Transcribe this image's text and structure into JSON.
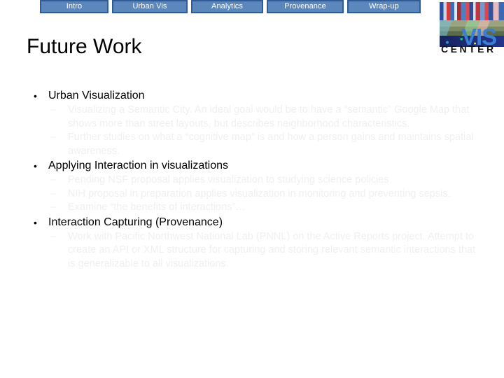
{
  "nav": {
    "tabs": [
      {
        "label": "Intro",
        "width_class": "w-intro"
      },
      {
        "label": "Urban Vis",
        "width_class": "w-urbanvis"
      },
      {
        "label": "Analytics",
        "width_class": "w-analytics"
      },
      {
        "label": "Provenance",
        "width_class": "w-provenance"
      },
      {
        "label": "Wrap-up",
        "width_class": "w-wrapup"
      }
    ],
    "tab_fill_color": "#5b87bd",
    "tab_border_color": "#2f5c98",
    "tab_text_color": "#ffffff"
  },
  "logo": {
    "word_primary": "VIS",
    "word_secondary": "CENTER",
    "primary_color": "#3b7fd4",
    "secondary_color": "#111111"
  },
  "slide": {
    "title": "Future Work",
    "title_color": "#000000",
    "body_level1_color": "#000000",
    "body_level2_color": "#f0f0f0",
    "bullet_marker_level1": "•",
    "bullet_marker_level2": "–",
    "bullets": [
      {
        "level": 1,
        "text": "Urban Visualization"
      },
      {
        "level": 2,
        "text": "Visualizing a Semantic City.  An ideal goal would be to have a “semantic” Google Map that shows more than street layouts, but describes neighborhood characteristics."
      },
      {
        "level": 2,
        "text": "Further studies on what a “cognitive map” is and how a person gains and maintains spatial awareness."
      },
      {
        "level": 1,
        "text": "Applying Interaction in visualizations"
      },
      {
        "level": 2,
        "text": "Pending NSF proposal applies visualization to studying science policies"
      },
      {
        "level": 2,
        "text": "NIH proposal in preparation applies visualization in monitoring and preventing sepsis."
      },
      {
        "level": 2,
        "text": "Examine “the benefits of interactions”…"
      },
      {
        "level": 1,
        "text": "Interaction Capturing (Provenance)"
      },
      {
        "level": 2,
        "text": "Work with Pacific Northwest National Lab (PNNL) on the Active Reports project.  Attempt to create an API or XML structure for capturing and storing relevant semantic interactions that is generalizable to all visualizations."
      }
    ]
  }
}
